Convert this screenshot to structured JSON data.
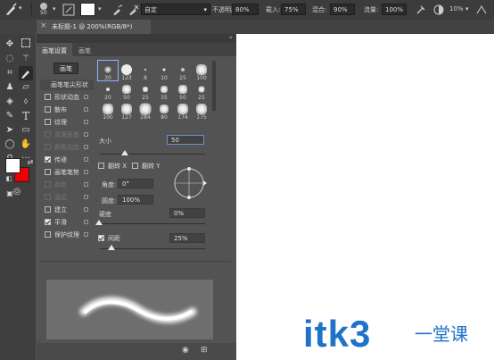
{
  "options_bar": {
    "brush_size": "50",
    "mode_value": "自定",
    "opacity_label": "不透明度:",
    "opacity_value": "80%",
    "flow_load_label": "载入:",
    "flow_load_value": "75%",
    "mix_label": "混合:",
    "mix_value": "90%",
    "flow_label": "流量:",
    "flow_value": "100%",
    "angle_value": "10%"
  },
  "document_tab": {
    "title": "未标题-1 @ 200%(RGB/8*)",
    "close": "×"
  },
  "panel": {
    "tabs": [
      "画笔设置",
      "画笔"
    ],
    "brush_button": "画笔",
    "options": [
      {
        "label": "画笔笔尖形状",
        "checkbox": false,
        "lock": false,
        "enabled": true
      },
      {
        "label": "形状动态",
        "checkbox": true,
        "checked": false,
        "lock": true,
        "enabled": true
      },
      {
        "label": "散布",
        "checkbox": true,
        "checked": false,
        "lock": true,
        "enabled": true
      },
      {
        "label": "纹理",
        "checkbox": true,
        "checked": false,
        "lock": true,
        "enabled": true
      },
      {
        "label": "双重画笔",
        "checkbox": true,
        "checked": false,
        "lock": true,
        "enabled": false
      },
      {
        "label": "颜色动态",
        "checkbox": true,
        "checked": false,
        "lock": true,
        "enabled": false
      },
      {
        "label": "传递",
        "checkbox": true,
        "checked": true,
        "lock": true,
        "enabled": true
      },
      {
        "label": "画笔笔势",
        "checkbox": true,
        "checked": false,
        "lock": true,
        "enabled": true
      },
      {
        "label": "杂色",
        "checkbox": true,
        "checked": false,
        "lock": true,
        "enabled": false
      },
      {
        "label": "湿边",
        "checkbox": true,
        "checked": false,
        "lock": true,
        "enabled": false
      },
      {
        "label": "建立",
        "checkbox": true,
        "checked": false,
        "lock": true,
        "enabled": true
      },
      {
        "label": "平滑",
        "checkbox": true,
        "checked": true,
        "lock": true,
        "enabled": true
      },
      {
        "label": "保护纹理",
        "checkbox": true,
        "checked": false,
        "lock": true,
        "enabled": true
      }
    ],
    "brush_presets": [
      "30",
      "123",
      "8",
      "10",
      "25",
      "100",
      "20",
      "50",
      "25",
      "35",
      "50",
      "25",
      "100",
      "127",
      "284",
      "80",
      "174",
      "175"
    ],
    "size_label": "大小",
    "size_value": "50",
    "flip_x_label": "翻转 X",
    "flip_y_label": "翻转 Y",
    "angle_label": "角度:",
    "angle_value": "0°",
    "roundness_label": "圆度:",
    "roundness_value": "100%",
    "hardness_label": "硬度",
    "hardness_value": "0%",
    "spacing_label": "间距",
    "spacing_value": "25%"
  },
  "watermark": {
    "text": "itk3",
    "suffix": "一堂课"
  },
  "colors": {
    "foreground": "#ffffff",
    "background": "#ee0000",
    "watermark_blue": "#1e73c8"
  }
}
